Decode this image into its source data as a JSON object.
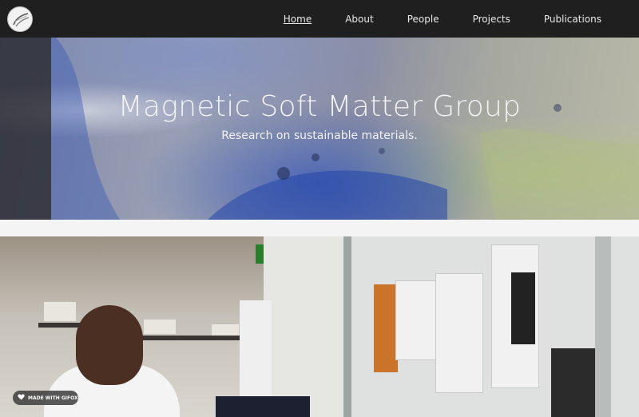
{
  "nav": {
    "items": [
      {
        "label": "Home",
        "active": true
      },
      {
        "label": "About",
        "active": false
      },
      {
        "label": "People",
        "active": false
      },
      {
        "label": "Projects",
        "active": false
      },
      {
        "label": "Publications",
        "active": false
      }
    ]
  },
  "hero": {
    "title": "Magnetic Soft Matter Group",
    "subtitle": "Research on sustainable materials."
  },
  "badge": {
    "label": "MADE WITH GIFOX"
  },
  "colors": {
    "nav_bg": "#1f1f1f",
    "nav_text": "#e8e8e8",
    "hero_text": "#f3f3f6"
  },
  "icons": {
    "logo": "group-logo-icon",
    "badge": "gifox-heart-icon"
  }
}
